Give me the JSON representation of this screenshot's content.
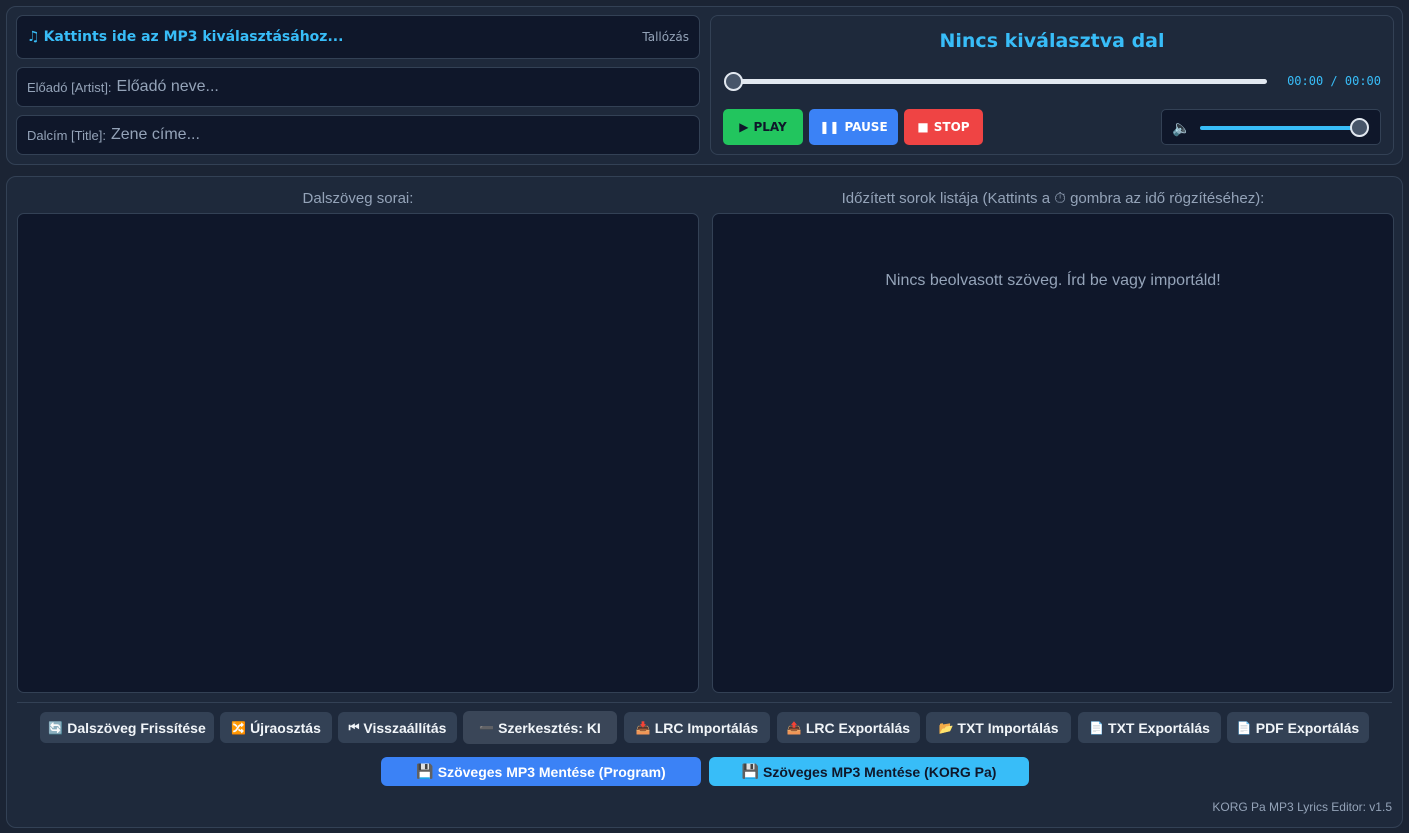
{
  "file": {
    "icon": "music-note-icon",
    "select_label": "Kattints ide az MP3 kiválasztásához...",
    "browse_label": "Tallózás"
  },
  "artist": {
    "label": "Előadó [Artist]:",
    "placeholder": "Előadó neve..."
  },
  "title": {
    "label": "Dalcím [Title]:",
    "placeholder": "Zene címe..."
  },
  "player": {
    "song_title": "Nincs kiválasztva dal",
    "time": "00:00 / 00:00",
    "progress": 0,
    "volume": 1,
    "play": "PLAY",
    "pause": "PAUSE",
    "stop": "STOP"
  },
  "lyrics": {
    "heading": "Dalszöveg sorai:"
  },
  "timed": {
    "heading": "Időzített sorok listája (Kattints a ⏱ gombra az idő rögzítéséhez):",
    "empty_message": "Nincs beolvasott szöveg. Írd be vagy importáld!"
  },
  "toolbar": {
    "refresh": "Dalszöveg Frissítése",
    "redistribute": "Újraosztás",
    "reset": "Visszaállítás",
    "edit": "Szerkesztés: KI",
    "lrc_import": "LRC Importálás",
    "lrc_export": "LRC Exportálás",
    "txt_import": "TXT Importálás",
    "txt_export": "TXT Exportálás",
    "pdf_export": "PDF Exportálás"
  },
  "save": {
    "program": "Szöveges MP3 Mentése (Program)",
    "korg": "Szöveges MP3 Mentése (KORG Pa)"
  },
  "footer": "KORG Pa MP3 Lyrics Editor: v1.5",
  "colors": {
    "accent": "#38bdf8",
    "play": "#22c55e",
    "pause": "#3b82f6",
    "stop": "#ef4444"
  }
}
